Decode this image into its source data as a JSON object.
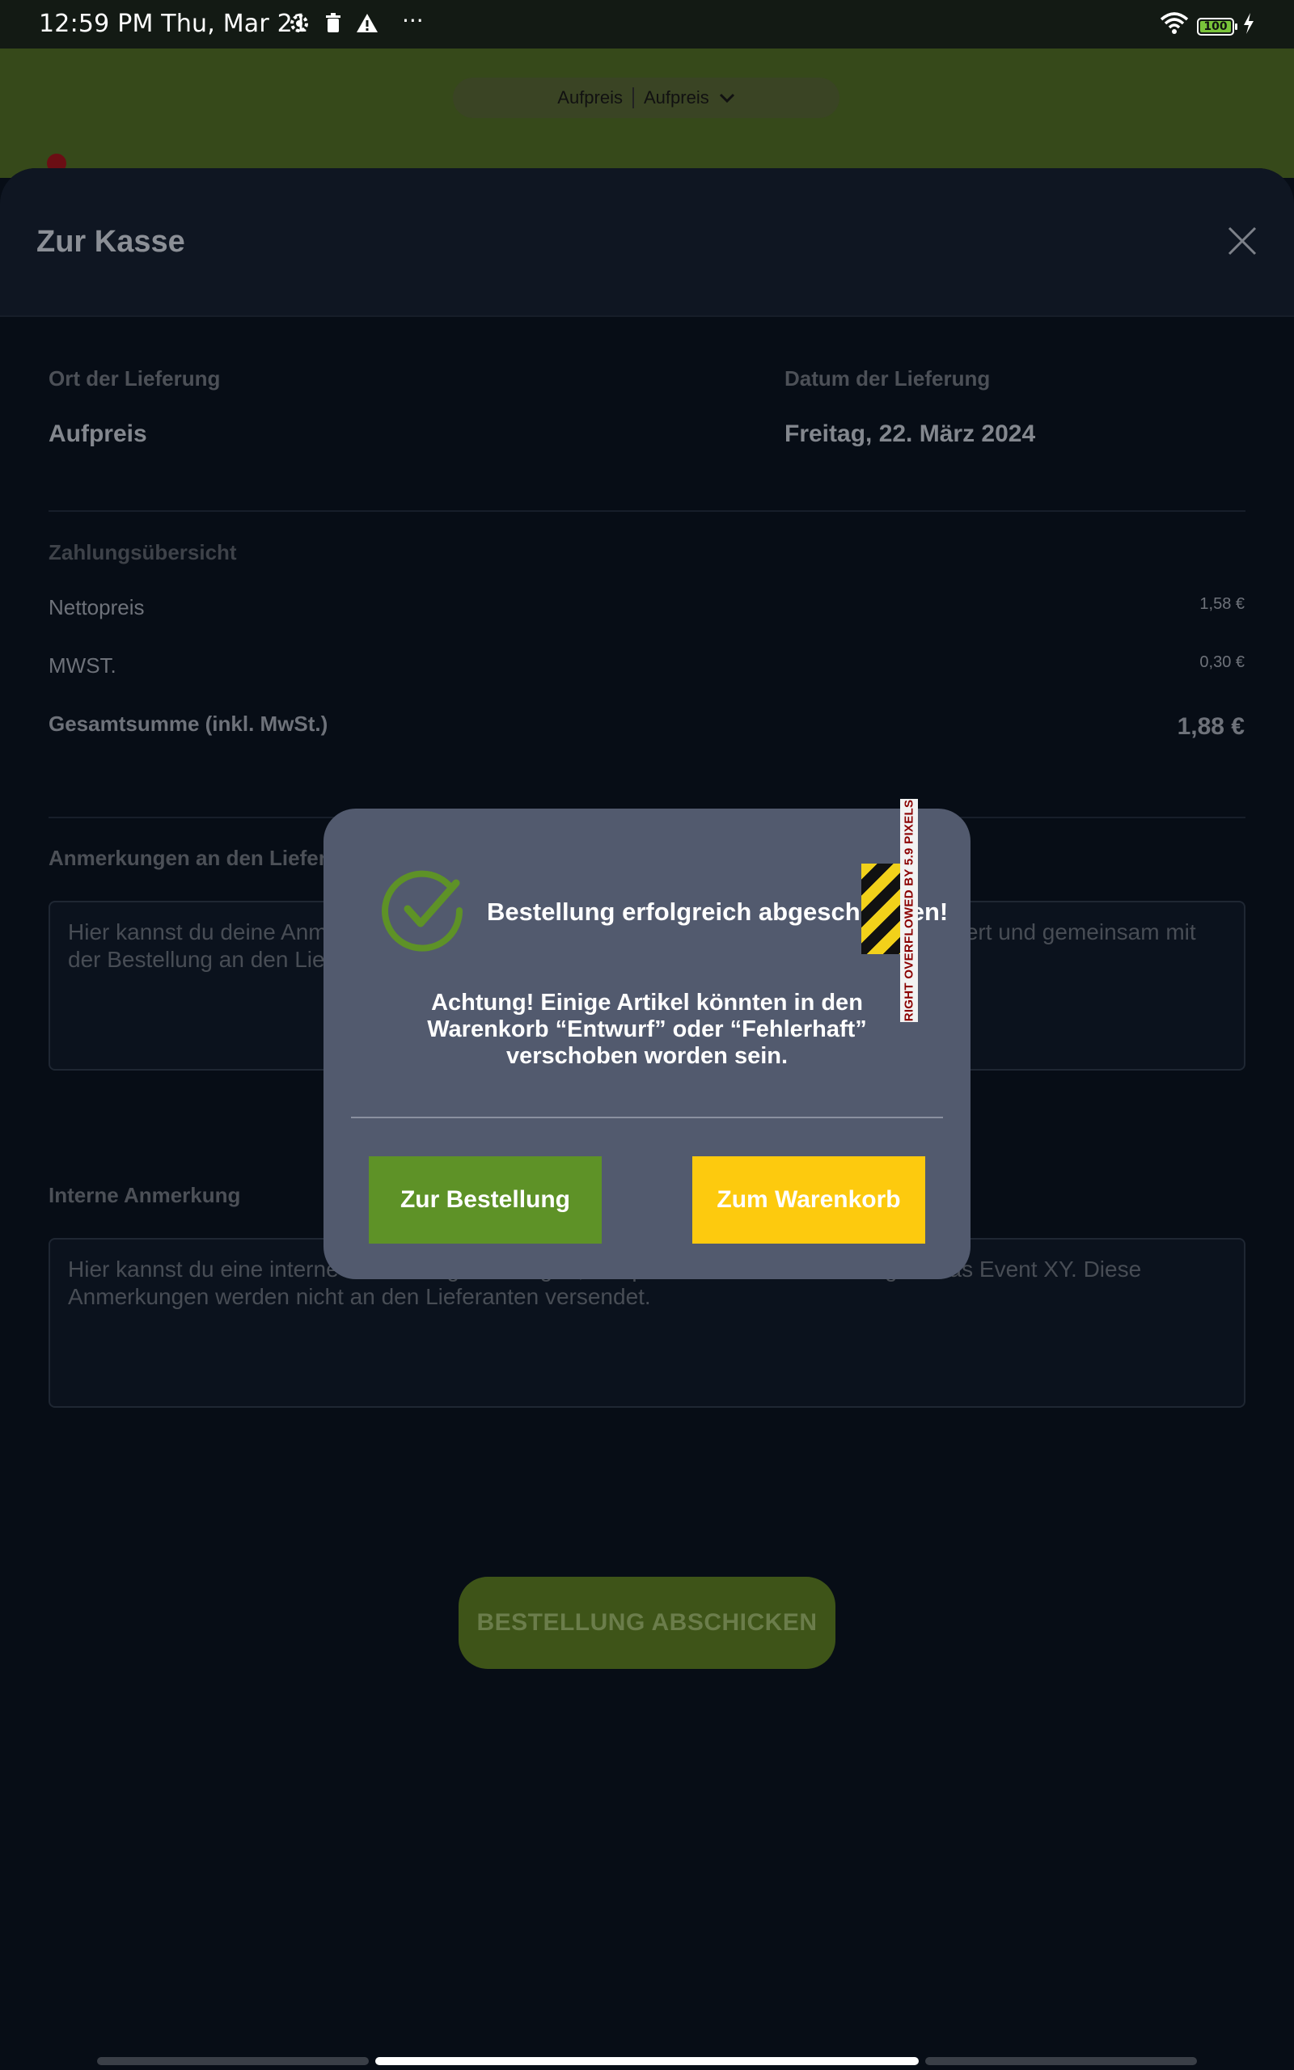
{
  "status_bar": {
    "time": "12:59 PM Thu, Mar 21",
    "more": "···",
    "battery": "100",
    "icons": [
      "settings-icon",
      "trash-icon",
      "warning-icon",
      "wifi-icon",
      "battery-icon",
      "charging-icon"
    ]
  },
  "background": {
    "location_left": "Aufpreis",
    "location_right": "Aufpreis"
  },
  "sheet": {
    "title": "Zur Kasse",
    "delivery_place_label": "Ort der Lieferung",
    "delivery_place_value": "Aufpreis",
    "delivery_date_label": "Datum der Lieferung",
    "delivery_date_value": "Freitag, 22. März 2024",
    "payment_overview_label": "Zahlungsübersicht",
    "net_label": "Nettopreis",
    "net_value": "1,58 €",
    "vat_label": "MWST.",
    "vat_value": "0,30 €",
    "total_label": "Gesamtsumme (inkl. MwSt.)",
    "total_value": "1,88 €",
    "supplier_notes_label": "Anmerkungen an den Lieferanten",
    "supplier_notes_placeholder": "Hier kannst du deine Anmerkungen für den Lieferanten eingeben. Diese werden gespeichert und gemeinsam mit der Bestellung an den Lieferanten versendet.",
    "internal_notes_label": "Interne Anmerkung",
    "internal_notes_placeholder": "Hier kannst du eine interne Anmerkung hinterlegen, beispielsweise eine Bestellung für das Event XY. Diese Anmerkungen werden nicht an den Lieferanten versendet.",
    "submit_label": "BESTELLUNG ABSCHICKEN"
  },
  "dialog": {
    "title": "Bestellung erfolgreich abgeschlossen!",
    "body": "Achtung! Einige Artikel könnten in den Warenkorb “Entwurf” oder “Fehlerhaft” verschoben worden sein.",
    "overflow_label": "RIGHT OVERFLOWED BY 5.9 PIXELS",
    "order_button": "Zur Bestellung",
    "cart_button": "Zum Warenkorb"
  },
  "colors": {
    "accent_green": "#5e9227",
    "accent_yellow": "#fdca0e",
    "dialog_bg": "#525a6e",
    "page_bg": "#070d16"
  }
}
